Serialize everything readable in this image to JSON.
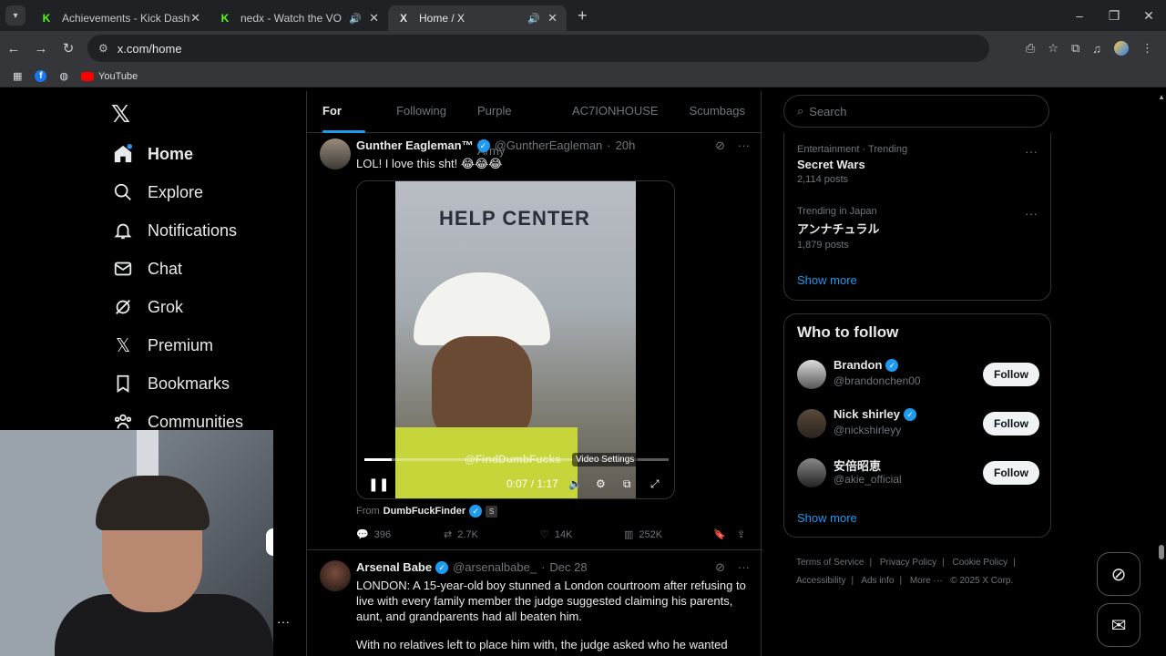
{
  "browser": {
    "tabs": [
      {
        "title": "Achievements - Kick Dashboard",
        "favicon": "K",
        "favicon_color": "#53fc18",
        "active": false,
        "audio": false
      },
      {
        "title": "nedx - Watch the VOD on Kick",
        "favicon": "K",
        "favicon_color": "#53fc18",
        "active": false,
        "audio": true
      },
      {
        "title": "Home / X",
        "favicon": "X",
        "favicon_color": "#e7e9ea",
        "active": true,
        "audio": true
      }
    ],
    "url": "x.com/home",
    "bookmarks": [
      {
        "label": "YouTube"
      }
    ]
  },
  "nav": {
    "items": [
      {
        "label": "Home",
        "icon": "home-icon"
      },
      {
        "label": "Explore",
        "icon": "search-icon"
      },
      {
        "label": "Notifications",
        "icon": "bell-icon"
      },
      {
        "label": "Chat",
        "icon": "mail-icon"
      },
      {
        "label": "Grok",
        "icon": "grok-icon"
      },
      {
        "label": "Premium",
        "icon": "x-icon"
      },
      {
        "label": "Bookmarks",
        "icon": "bookmark-icon"
      },
      {
        "label": "Communities",
        "icon": "people-icon"
      }
    ]
  },
  "feed_tabs": [
    "For you",
    "Following",
    "Purple Army",
    "AC7IONHOUSE",
    "Scumbags"
  ],
  "tweets": [
    {
      "name": "Gunther Eagleman™",
      "handle": "@GuntherEagleman",
      "time": "20h",
      "text": "LOL!  I love this sht! 😂😂😂",
      "video": {
        "sign": "HELP CENTER",
        "watermark": "@FindDumbFucks",
        "tooltip": "Video Settings",
        "time": "0:07 / 1:17",
        "progress": 0.09
      },
      "from_label": "From",
      "from_name": "DumbFuckFinder",
      "from_badge": "S",
      "stats": {
        "replies": "396",
        "reposts": "2.7K",
        "likes": "14K",
        "views": "252K"
      }
    },
    {
      "name": "Arsenal Babe",
      "handle": "@arsenalbabe_",
      "time": "Dec 28",
      "text": "LONDON: A 15-year-old boy stunned a London courtroom after refusing to live with every family member the judge suggested claiming his parents, aunt, and grandparents had all beaten him.",
      "text2": "With no relatives left to place him with, the judge asked who he wanted"
    }
  ],
  "search": {
    "placeholder": "Search"
  },
  "trends": [
    {
      "category": "Entertainment · Trending",
      "name": "Secret Wars",
      "count": "2,114 posts"
    },
    {
      "category": "Trending in Japan",
      "name": "アンナチュラル",
      "count": "1,879 posts"
    }
  ],
  "show_more": "Show more",
  "who_to_follow": {
    "title": "Who to follow",
    "people": [
      {
        "name": "Brandon",
        "handle": "@brandonchen00",
        "verified": true,
        "button": "Follow"
      },
      {
        "name": "Nick shirley",
        "handle": "@nickshirleyy",
        "verified": true,
        "button": "Follow"
      },
      {
        "name": "安倍昭恵",
        "handle": "@akie_official",
        "verified": false,
        "button": "Follow"
      }
    ],
    "show_more": "Show more"
  },
  "footer": {
    "links": [
      "Terms of Service",
      "Privacy Policy",
      "Cookie Policy",
      "Accessibility",
      "Ads info",
      "More ···"
    ],
    "copyright": "© 2025 X Corp."
  },
  "colors": {
    "accent": "#1d9bf0",
    "background": "#000000",
    "border": "#2f3336"
  }
}
